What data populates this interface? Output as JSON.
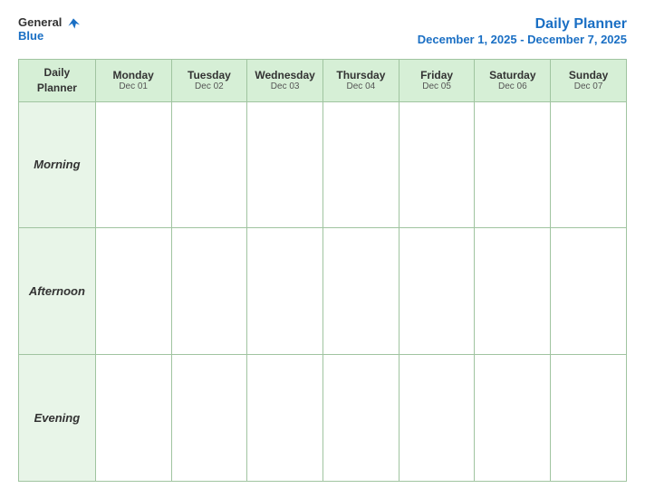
{
  "header": {
    "logo_general": "General",
    "logo_blue": "Blue",
    "title": "Daily Planner",
    "subtitle": "December 1, 2025 - December 7, 2025"
  },
  "table": {
    "header_label": "Daily\nPlanner",
    "columns": [
      {
        "id": "mon",
        "day": "Monday",
        "date": "Dec 01"
      },
      {
        "id": "tue",
        "day": "Tuesday",
        "date": "Dec 02"
      },
      {
        "id": "wed",
        "day": "Wednesday",
        "date": "Dec 03"
      },
      {
        "id": "thu",
        "day": "Thursday",
        "date": "Dec 04"
      },
      {
        "id": "fri",
        "day": "Friday",
        "date": "Dec 05"
      },
      {
        "id": "sat",
        "day": "Saturday",
        "date": "Dec 06"
      },
      {
        "id": "sun",
        "day": "Sunday",
        "date": "Dec 07"
      }
    ],
    "rows": [
      {
        "id": "morning",
        "label": "Morning"
      },
      {
        "id": "afternoon",
        "label": "Afternoon"
      },
      {
        "id": "evening",
        "label": "Evening"
      }
    ]
  }
}
